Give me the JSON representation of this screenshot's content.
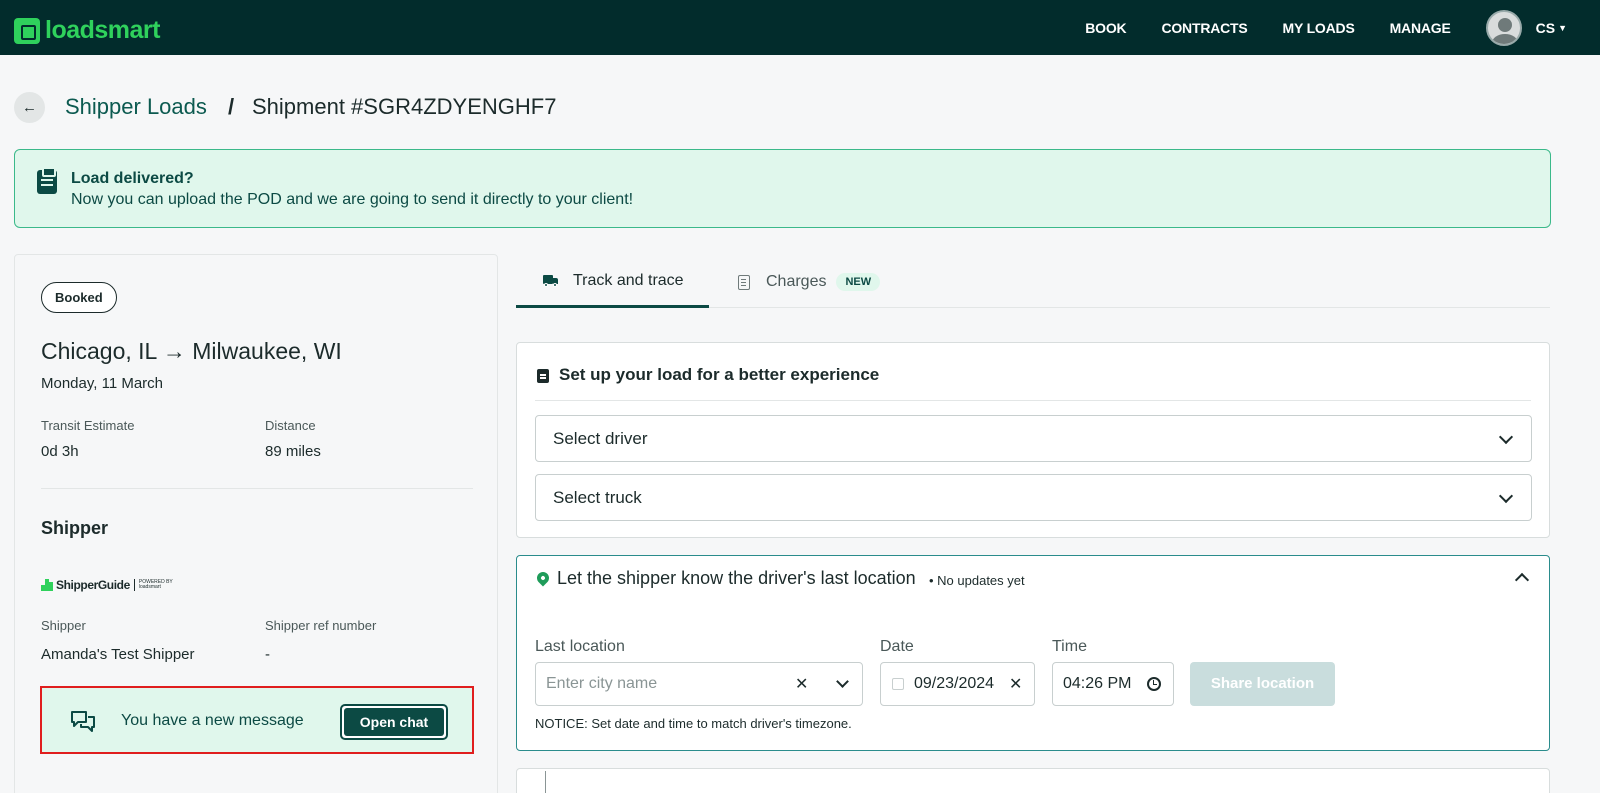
{
  "brand": {
    "name": "loadsmart",
    "color": "#2fd15c"
  },
  "nav": {
    "items": [
      "BOOK",
      "CONTRACTS",
      "MY LOADS",
      "MANAGE"
    ],
    "user_initials": "CS"
  },
  "breadcrumb": {
    "parent": "Shipper Loads",
    "separator": "/",
    "current": "Shipment #SGR4ZDYENGHF7"
  },
  "banner": {
    "title": "Load delivered?",
    "text": "Now you can upload the POD and we are going to send it directly to your client!"
  },
  "load": {
    "status": "Booked",
    "route": "Chicago, IL → Milwaukee, WI",
    "date": "Monday, 11 March",
    "transit_label": "Transit Estimate",
    "transit_value": "0d 3h",
    "distance_label": "Distance",
    "distance_value": "89 miles"
  },
  "shipper": {
    "section_title": "Shipper",
    "logo_text": "ShipperGuide",
    "logo_powered": "POWERED BY",
    "logo_powered_brand": "loadsmart",
    "shipper_label": "Shipper",
    "shipper_value": "Amanda's Test Shipper",
    "ref_label": "Shipper ref number",
    "ref_value": "-"
  },
  "message": {
    "text": "You have a new message",
    "button": "Open chat"
  },
  "tabs": [
    {
      "label": "Track and trace",
      "active": true
    },
    {
      "label": "Charges",
      "badge": "NEW",
      "active": false
    }
  ],
  "setup": {
    "title": "Set up your load for a better experience",
    "driver_select": "Select driver",
    "truck_select": "Select truck"
  },
  "location": {
    "title": "Let the shipper know the driver's last location",
    "subtitle": "• No updates yet",
    "last_location_label": "Last location",
    "last_location_placeholder": "Enter city name",
    "date_label": "Date",
    "date_value": "09/23/2024",
    "time_label": "Time",
    "time_value": "04:26 PM",
    "share_button": "Share location",
    "notice": "NOTICE: Set date and time to match driver's timezone."
  }
}
